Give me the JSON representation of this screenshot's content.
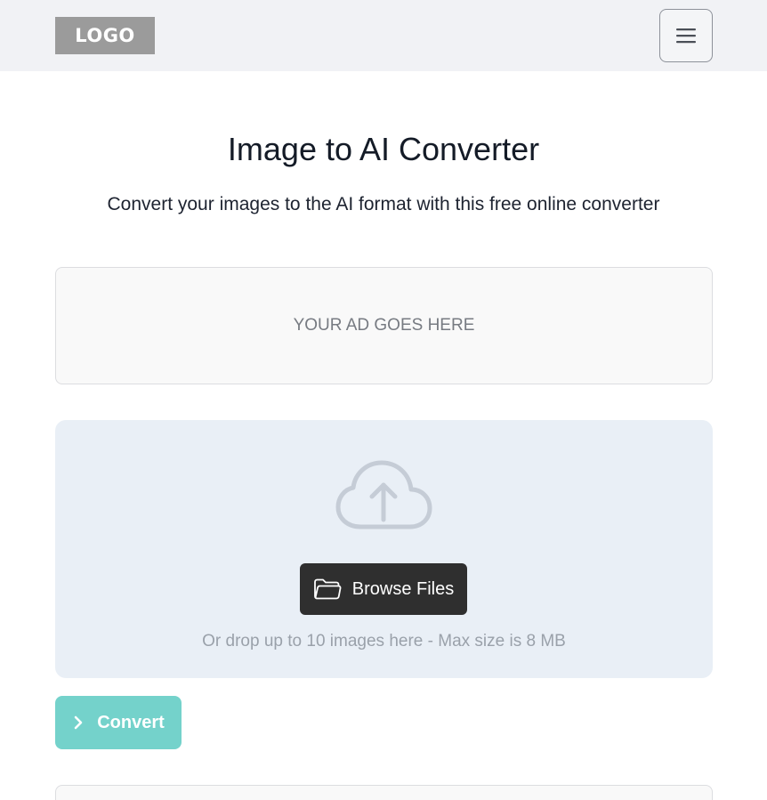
{
  "header": {
    "logo_text": "LOGO",
    "menu_icon": "hamburger-menu-icon"
  },
  "main": {
    "title": "Image to AI Converter",
    "subtitle": "Convert your images to the AI format with this free online converter"
  },
  "ad": {
    "text": "YOUR AD GOES HERE"
  },
  "upload": {
    "icon": "cloud-upload-icon",
    "browse_label": "Browse Files",
    "browse_icon": "folder-open-icon",
    "hint": "Or drop up to 10 images here - Max size is 8 MB"
  },
  "actions": {
    "convert_label": "Convert",
    "convert_icon": "chevron-right-icon"
  },
  "colors": {
    "header_bg": "#f1f2f5",
    "logo_bg": "#9b9b9b",
    "drop_zone_bg": "#e9eff6",
    "browse_bg": "#2f2f2f",
    "convert_bg": "#74d2cb"
  }
}
